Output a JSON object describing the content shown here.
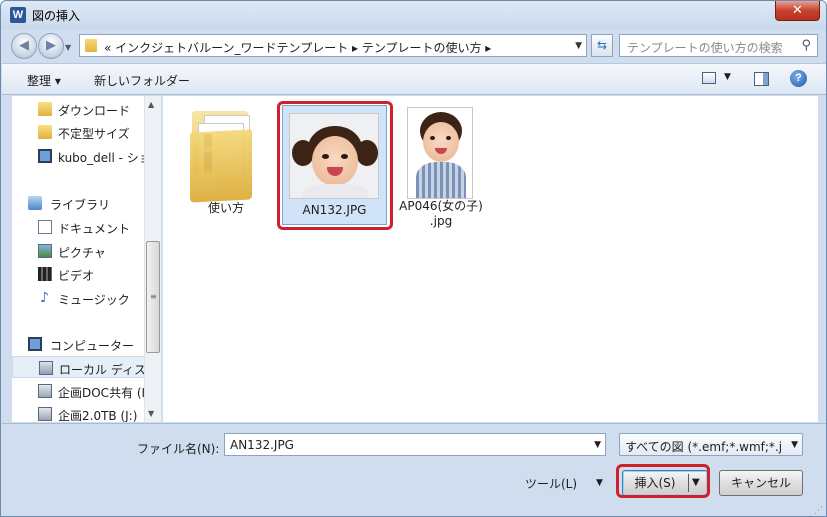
{
  "window": {
    "title": "図の挿入",
    "app_icon_letter": "W",
    "close_label": "✕"
  },
  "address_bar": {
    "path_text": "«  インクジェトバルーン_ワードテンプレート  ▸  テンプレートの使い方  ▸",
    "search_placeholder": "テンプレートの使い方の検索"
  },
  "toolbar": {
    "organize_label": "整理 ▾",
    "new_folder_label": "新しいフォルダー",
    "help_label": "?"
  },
  "nav_pane": {
    "items": [
      {
        "label": "ダウンロード",
        "icon": "folder-icon"
      },
      {
        "label": "不定型サイズ",
        "icon": "folder-icon"
      },
      {
        "label": "kubo_dell - ショートカット",
        "icon": "computer-icon"
      },
      {
        "label": "ライブラリ",
        "icon": "library-icon"
      },
      {
        "label": "ドキュメント",
        "icon": "document-icon"
      },
      {
        "label": "ピクチャ",
        "icon": "picture-icon"
      },
      {
        "label": "ビデオ",
        "icon": "video-icon"
      },
      {
        "label": "ミュージック",
        "icon": "music-icon"
      },
      {
        "label": "コンピューター",
        "icon": "computer-icon"
      },
      {
        "label": "ローカル ディスク (C:)",
        "icon": "drive-icon"
      },
      {
        "label": "企画DOC共有 (I:)",
        "icon": "network-drive-icon"
      },
      {
        "label": "企画2.0TB (J:)",
        "icon": "network-drive-icon"
      }
    ]
  },
  "files": [
    {
      "name": "使い方",
      "type": "folder"
    },
    {
      "name": "AN132.JPG",
      "type": "image",
      "selected": true
    },
    {
      "name": "AP046(女の子)\n.jpg",
      "type": "image"
    }
  ],
  "bottom": {
    "filename_label": "ファイル名(N):",
    "filename_value": "AN132.JPG",
    "filter_value": "すべての図 (*.emf;*.wmf;*.j",
    "tools_label": "ツール(L)",
    "insert_label": "挿入(S)",
    "cancel_label": "キャンセル"
  },
  "colors": {
    "highlight": "#d0202a",
    "selection": "#d0e3f8",
    "chrome": "#cfddee"
  }
}
